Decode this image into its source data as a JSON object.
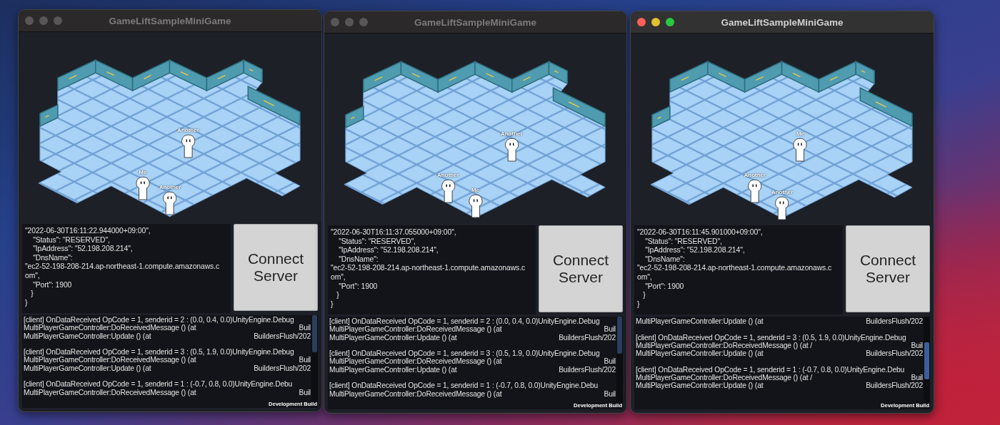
{
  "windows": [
    {
      "title": "GameLiftSampleMiniGame",
      "focused": false,
      "characters": [
        {
          "label": "Another"
        },
        {
          "label": "Me"
        },
        {
          "label": "Another"
        }
      ],
      "info": [
        "\"2022-06-30T16:11:22.944000+09:00\",",
        "\t\"Status\": \"RESERVED\",",
        "\t\"IpAddress\": \"52.198.208.214\",",
        "\t\"DnsName\":",
        "\"ec2-52-198-208-214.ap-northeast-1.compute.amazonaws.c",
        "om\",",
        "\t\"Port\": 1900",
        "   }",
        "}"
      ],
      "button": "Connect Server",
      "log": [
        {
          "lines": [
            {
              "text": "[client] OnDataReceived OpCode = 1, senderid = 2 : (0.0, 0.4, 0.0)UnityEngine.Debug"
            },
            {
              "text": "MultiPlayerGameController:DoReceivedMessage () (at",
              "tail": "Buil"
            },
            {
              "text": "MultiPlayerGameController:Update () (at",
              "tail": "BuildersFlush/202"
            }
          ]
        },
        {
          "lines": [
            {
              "text": "[client] OnDataReceived OpCode = 1, senderid = 3 : (0.5, 1.9, 0.0)UnityEngine.Debug"
            },
            {
              "text": "MultiPlayerGameController:DoReceivedMessage () (at",
              "tail": "Buil"
            },
            {
              "text": "MultiPlayerGameController:Update () (at",
              "tail": "BuildersFlush/202"
            }
          ]
        },
        {
          "lines": [
            {
              "text": "[client] OnDataReceived OpCode = 1, senderid = 1 : (-0.7, 0.8, 0.0)UnityEngine.Debu"
            },
            {
              "text": "MultiPlayerGameController:DoReceivedMessage () (at",
              "tail": "Buil"
            }
          ]
        }
      ],
      "build_label": "Development Build"
    },
    {
      "title": "GameLiftSampleMiniGame",
      "focused": false,
      "characters": [
        {
          "label": "Another"
        },
        {
          "label": "Another"
        },
        {
          "label": "Me"
        }
      ],
      "info": [
        "\"2022-06-30T16:11:37.055000+09:00\",",
        "\t\"Status\": \"RESERVED\",",
        "\t\"IpAddress\": \"52.198.208.214\",",
        "\t\"DnsName\":",
        "\"ec2-52-198-208-214.ap-northeast-1.compute.amazonaws.c",
        "om\",",
        "\t\"Port\": 1900",
        "   }",
        "}"
      ],
      "button": "Connect Server",
      "log": [
        {
          "lines": [
            {
              "text": "[client] OnDataReceived OpCode = 1, senderid = 2 : (0.0, 0.4, 0.0)UnityEngine.Debug"
            },
            {
              "text": "MultiPlayerGameController:DoReceivedMessage () (at",
              "tail": "Buil"
            },
            {
              "text": "MultiPlayerGameController:Update () (at",
              "tail": "BuildersFlush/202"
            }
          ]
        },
        {
          "lines": [
            {
              "text": "[client] OnDataReceived OpCode = 1, senderid = 3 : (0.5, 1.9, 0.0)UnityEngine.Debug"
            },
            {
              "text": "MultiPlayerGameController:DoReceivedMessage () (at",
              "tail": "Buil"
            },
            {
              "text": "MultiPlayerGameController:Update () (at",
              "tail": "BuildersFlush/202"
            }
          ]
        },
        {
          "lines": [
            {
              "text": "[client] OnDataReceived OpCode = 1, senderid = 1 : (-0.7, 0.8, 0.0)UnityEngine.Debu"
            },
            {
              "text": "MultiPlayerGameController:DoReceivedMessage () (at",
              "tail": "Buil"
            }
          ]
        }
      ],
      "build_label": "Development Build"
    },
    {
      "title": "GameLiftSampleMiniGame",
      "focused": true,
      "characters": [
        {
          "label": "Me"
        },
        {
          "label": "Another"
        },
        {
          "label": "Another"
        }
      ],
      "info": [
        "\"2022-06-30T16:11:45.901000+09:00\",",
        "\t\"Status\": \"RESERVED\",",
        "\t\"IpAddress\": \"52.198.208.214\",",
        "\t\"DnsName\":",
        "\"ec2-52-198-208-214.ap-northeast-1.compute.amazonaws.c",
        "om\",",
        "\t\"Port\": 1900",
        "   }",
        "}"
      ],
      "button": "Connect Server",
      "log": [
        {
          "lines": [
            {
              "text": "MultiPlayerGameController:Update () (at",
              "tail": "BuildersFlush/202"
            }
          ]
        },
        {
          "lines": [
            {
              "text": "[client] OnDataReceived OpCode = 1, senderid = 3 : (0.5, 1.9, 0.0)UnityEngine.Debug"
            },
            {
              "text": "MultiPlayerGameController:DoReceivedMessage () (at /",
              "tail": "Buil"
            },
            {
              "text": "MultiPlayerGameController:Update () (at",
              "tail": "BuildersFlush/202"
            }
          ]
        },
        {
          "lines": [
            {
              "text": "[client] OnDataReceived OpCode = 1, senderid = 1 : (-0.7, 0.8, 0.0)UnityEngine.Debu"
            },
            {
              "text": "MultiPlayerGameController:DoReceivedMessage () (at /",
              "tail": "Buil"
            },
            {
              "text": "MultiPlayerGameController:Update () (at",
              "tail": "BuildersFlush/202"
            }
          ]
        }
      ],
      "build_label": "Development Build"
    }
  ]
}
